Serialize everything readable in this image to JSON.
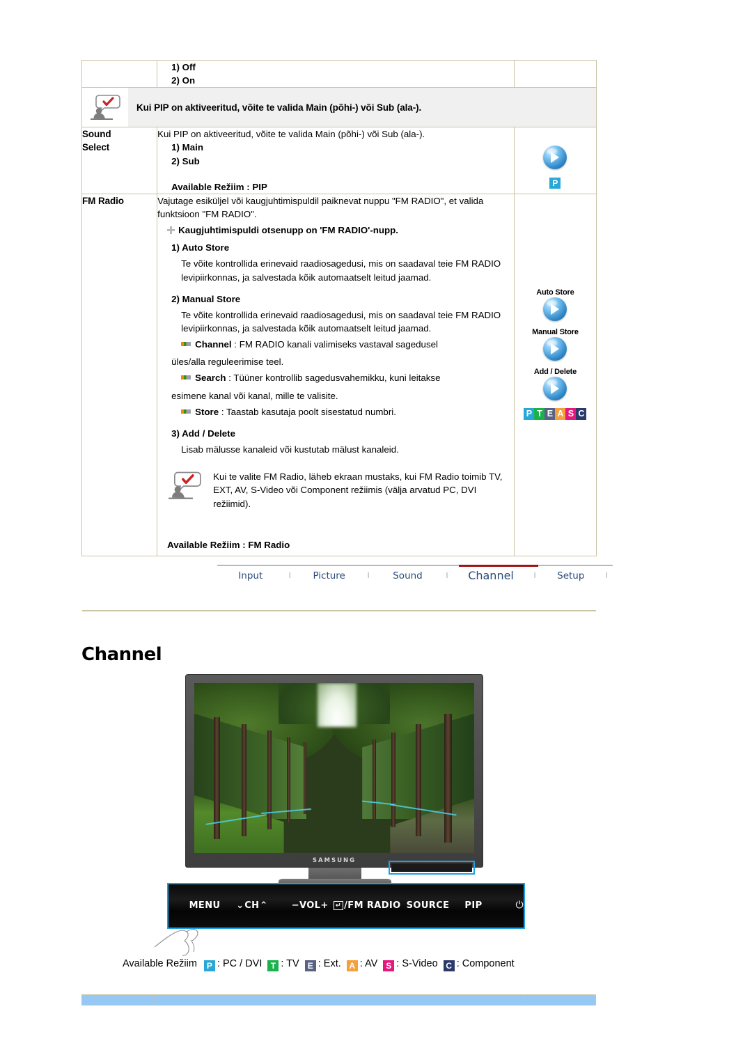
{
  "table": {
    "row_options": {
      "options": [
        "1) Off",
        "2) On"
      ]
    },
    "note_row": {
      "icon": "note-person-icon",
      "text": "Kui PIP on aktiveeritud, võite te valida Main (põhi-) või Sub (ala-)."
    },
    "sound_select": {
      "label_line1": "Sound",
      "label_line2": "Select",
      "intro": "Kui PIP on aktiveeritud, võite te valida Main (põhi-) või Sub (ala-).",
      "options": [
        "1) Main",
        "2) Sub"
      ],
      "available": "Available Režiim : PIP",
      "icon_badge": "P"
    },
    "fm_radio": {
      "label": "FM Radio",
      "intro": "Vajutage esiküljel või kaugjuhtimispuldil paiknevat nuppu \"FM RADIO\", et valida funktsioon \"FM RADIO\".",
      "remote_hint": "Kaugjuhtimispuldi otsenupp on 'FM RADIO'-nupp.",
      "items": [
        {
          "heading": "1) Auto Store",
          "body": "Te võite kontrollida erinevaid raadiosagedusi, mis on saadaval teie FM RADIO levipiirkonnas, ja salvestada kõik automaatselt leitud jaamad."
        },
        {
          "heading": "2) Manual Store",
          "body": "Te võite kontrollida erinevaid raadiosagedusi, mis on saadaval teie FM RADIO levipiirkonnas, ja salvestada kõik automaatselt leitud jaamad."
        }
      ],
      "dashes": [
        {
          "term": "Channel",
          "desc": " : FM RADIO kanali valimiseks vastaval sagedusel",
          "cont": "üles/alla reguleerimise teel."
        },
        {
          "term": "Search",
          "desc": " : Tüüner kontrollib sagedusvahemikku, kuni leitakse",
          "cont": "esimene kanal või kanal, mille te valisite."
        },
        {
          "term": "Store",
          "desc": " : Taastab kasutaja poolt sisestatud numbri.",
          "cont": ""
        }
      ],
      "add_delete": {
        "heading": "3) Add / Delete",
        "body": "Lisab mälusse kanaleid või kustutab mälust kanaleid."
      },
      "inline_note": "Kui te valite FM Radio, läheb ekraan mustaks, kui FM Radio toimib TV, EXT, AV, S-Video või Component režiimis (välja arvatud PC, DVI režiimid).",
      "available": "Available Režiim : FM Radio",
      "icons": [
        {
          "label": "Auto Store"
        },
        {
          "label": "Manual Store"
        },
        {
          "label": "Add / Delete"
        }
      ],
      "mode_badges": [
        "P",
        "T",
        "E",
        "A",
        "S",
        "C"
      ]
    }
  },
  "navbar": {
    "items": [
      "Input",
      "Picture",
      "Sound",
      "Channel",
      "Setup"
    ],
    "active": "Channel",
    "separator": "l",
    "active_color": "#9e1515"
  },
  "section": {
    "title": "Channel"
  },
  "figure": {
    "brand": "SAMSUNG",
    "panel_buttons": [
      "MENU",
      "⌄",
      "CH",
      "⌃",
      "−",
      "VOL",
      "+",
      "/FM RADIO",
      "SOURCE",
      "PIP",
      "⏻"
    ],
    "return_glyph": "↵",
    "highlight_color": "#1ca0e8"
  },
  "legend": {
    "prefix": "Available Režiim",
    "entries": [
      {
        "badge": "P",
        "text": ": PC / DVI",
        "color": "#29a8d8"
      },
      {
        "badge": "T",
        "text": ": TV",
        "color": "#1bb14c"
      },
      {
        "badge": "E",
        "text": ": Ext.",
        "color": "#5a6283"
      },
      {
        "badge": "A",
        "text": ": AV",
        "color": "#f5a03c"
      },
      {
        "badge": "S",
        "text": ": S-Video",
        "color": "#e5187e"
      },
      {
        "badge": "C",
        "text": ": Component",
        "color": "#2c3a6b"
      }
    ]
  }
}
